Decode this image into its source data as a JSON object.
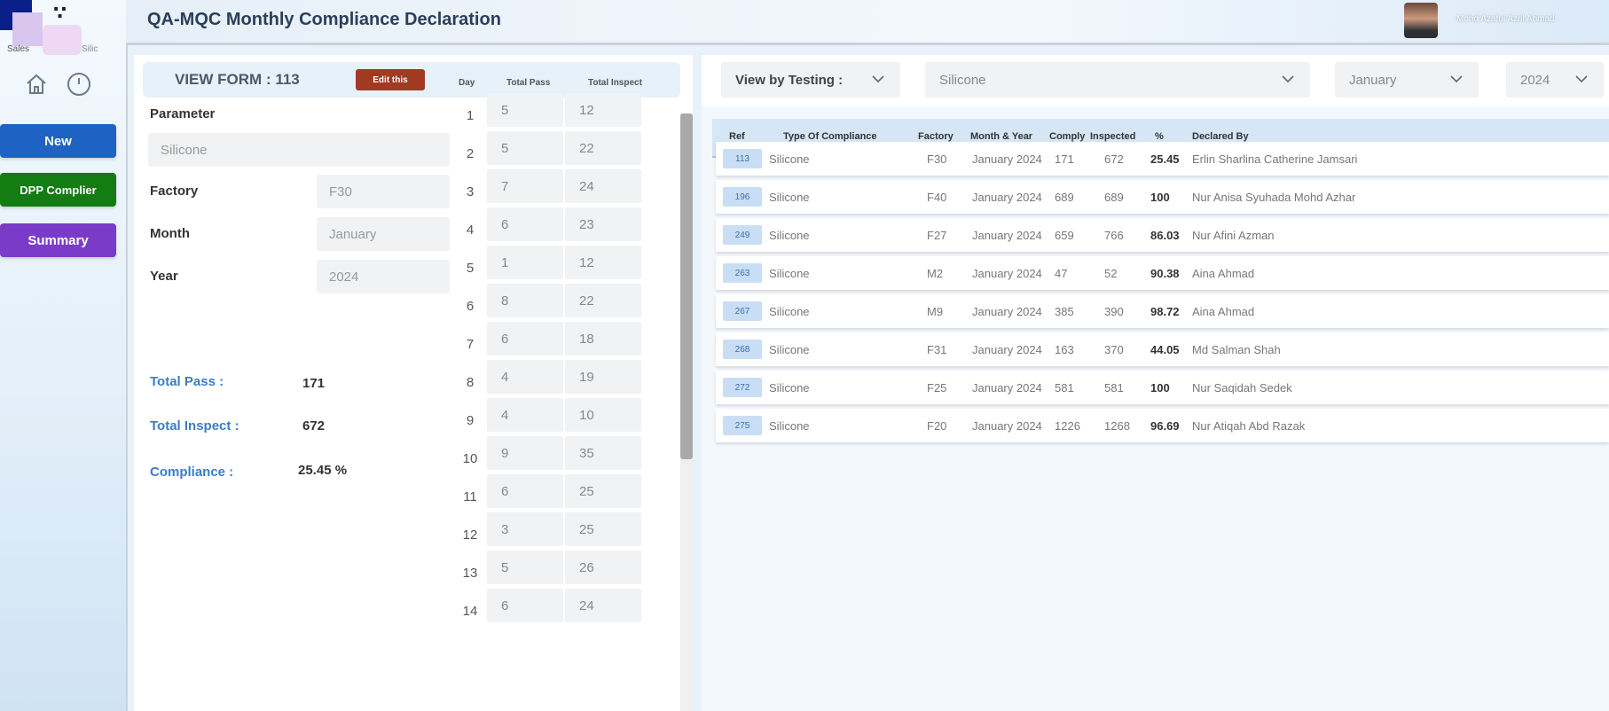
{
  "app": {
    "title": "QA-MQC Monthly Compliance Declaration",
    "user_name": "Mohd Azaful Azril Ahmad"
  },
  "sidebar": {
    "new_label": "New",
    "dpp_label": "DPP Complier",
    "summary_label": "Summary",
    "home_icon": "home-icon",
    "back_icon": "back-icon"
  },
  "form": {
    "view_form_label": "VIEW FORM : 113",
    "edit_label": "Edit this",
    "col_day": "Day",
    "col_total_pass": "Total Pass",
    "col_total_inspect": "Total Inspect",
    "parameter_label": "Parameter",
    "parameter_value": "Silicone",
    "factory_label": "Factory",
    "factory_value": "F30",
    "month_label": "Month",
    "month_value": "January",
    "year_label": "Year",
    "year_value": "2024",
    "total_pass_label": "Total Pass :",
    "total_pass_value": "171",
    "total_inspect_label": "Total Inspect :",
    "total_inspect_value": "672",
    "compliance_label": "Compliance :",
    "compliance_value": "25.45 %",
    "days": [
      {
        "day": "1",
        "pass": "5",
        "inspect": "12"
      },
      {
        "day": "2",
        "pass": "5",
        "inspect": "22"
      },
      {
        "day": "3",
        "pass": "7",
        "inspect": "24"
      },
      {
        "day": "4",
        "pass": "6",
        "inspect": "23"
      },
      {
        "day": "5",
        "pass": "1",
        "inspect": "12"
      },
      {
        "day": "6",
        "pass": "8",
        "inspect": "22"
      },
      {
        "day": "7",
        "pass": "6",
        "inspect": "18"
      },
      {
        "day": "8",
        "pass": "4",
        "inspect": "19"
      },
      {
        "day": "9",
        "pass": "4",
        "inspect": "10"
      },
      {
        "day": "10",
        "pass": "9",
        "inspect": "35"
      },
      {
        "day": "11",
        "pass": "6",
        "inspect": "25"
      },
      {
        "day": "12",
        "pass": "3",
        "inspect": "25"
      },
      {
        "day": "13",
        "pass": "5",
        "inspect": "26"
      },
      {
        "day": "14",
        "pass": "6",
        "inspect": "24"
      }
    ]
  },
  "filters": {
    "view_by": "View by Testing :",
    "parameter": "Silicone",
    "month": "January",
    "year": "2024"
  },
  "table": {
    "headers": {
      "ref": "Ref",
      "type": "Type Of Compliance",
      "factory": "Factory",
      "month_year": "Month & Year",
      "comply": "Comply",
      "inspected": "Inspected",
      "pct": "%",
      "declared_by": "Declared By"
    },
    "rows": [
      {
        "ref": "113",
        "type": "Silicone",
        "factory": "F30",
        "month_year": "January 2024",
        "comply": "171",
        "inspected": "672",
        "pct": "25.45",
        "declared_by": "Erlin Sharlina Catherine Jamsari"
      },
      {
        "ref": "196",
        "type": "Silicone",
        "factory": "F40",
        "month_year": "January 2024",
        "comply": "689",
        "inspected": "689",
        "pct": "100",
        "declared_by": "Nur Anisa Syuhada Mohd Azhar"
      },
      {
        "ref": "249",
        "type": "Silicone",
        "factory": "F27",
        "month_year": "January 2024",
        "comply": "659",
        "inspected": "766",
        "pct": "86.03",
        "declared_by": "Nur Afini Azman"
      },
      {
        "ref": "263",
        "type": "Silicone",
        "factory": "M2",
        "month_year": "January 2024",
        "comply": "47",
        "inspected": "52",
        "pct": "90.38",
        "declared_by": "Aina Ahmad"
      },
      {
        "ref": "267",
        "type": "Silicone",
        "factory": "M9",
        "month_year": "January 2024",
        "comply": "385",
        "inspected": "390",
        "pct": "98.72",
        "declared_by": "Aina Ahmad"
      },
      {
        "ref": "268",
        "type": "Silicone",
        "factory": "F31",
        "month_year": "January 2024",
        "comply": "163",
        "inspected": "370",
        "pct": "44.05",
        "declared_by": "Md Salman Shah"
      },
      {
        "ref": "272",
        "type": "Silicone",
        "factory": "F25",
        "month_year": "January 2024",
        "comply": "581",
        "inspected": "581",
        "pct": "100",
        "declared_by": "Nur Saqidah Sedek"
      },
      {
        "ref": "275",
        "type": "Silicone",
        "factory": "F20",
        "month_year": "January 2024",
        "comply": "1226",
        "inspected": "1268",
        "pct": "96.69",
        "declared_by": "Nur Atiqah Abd Razak"
      }
    ]
  }
}
